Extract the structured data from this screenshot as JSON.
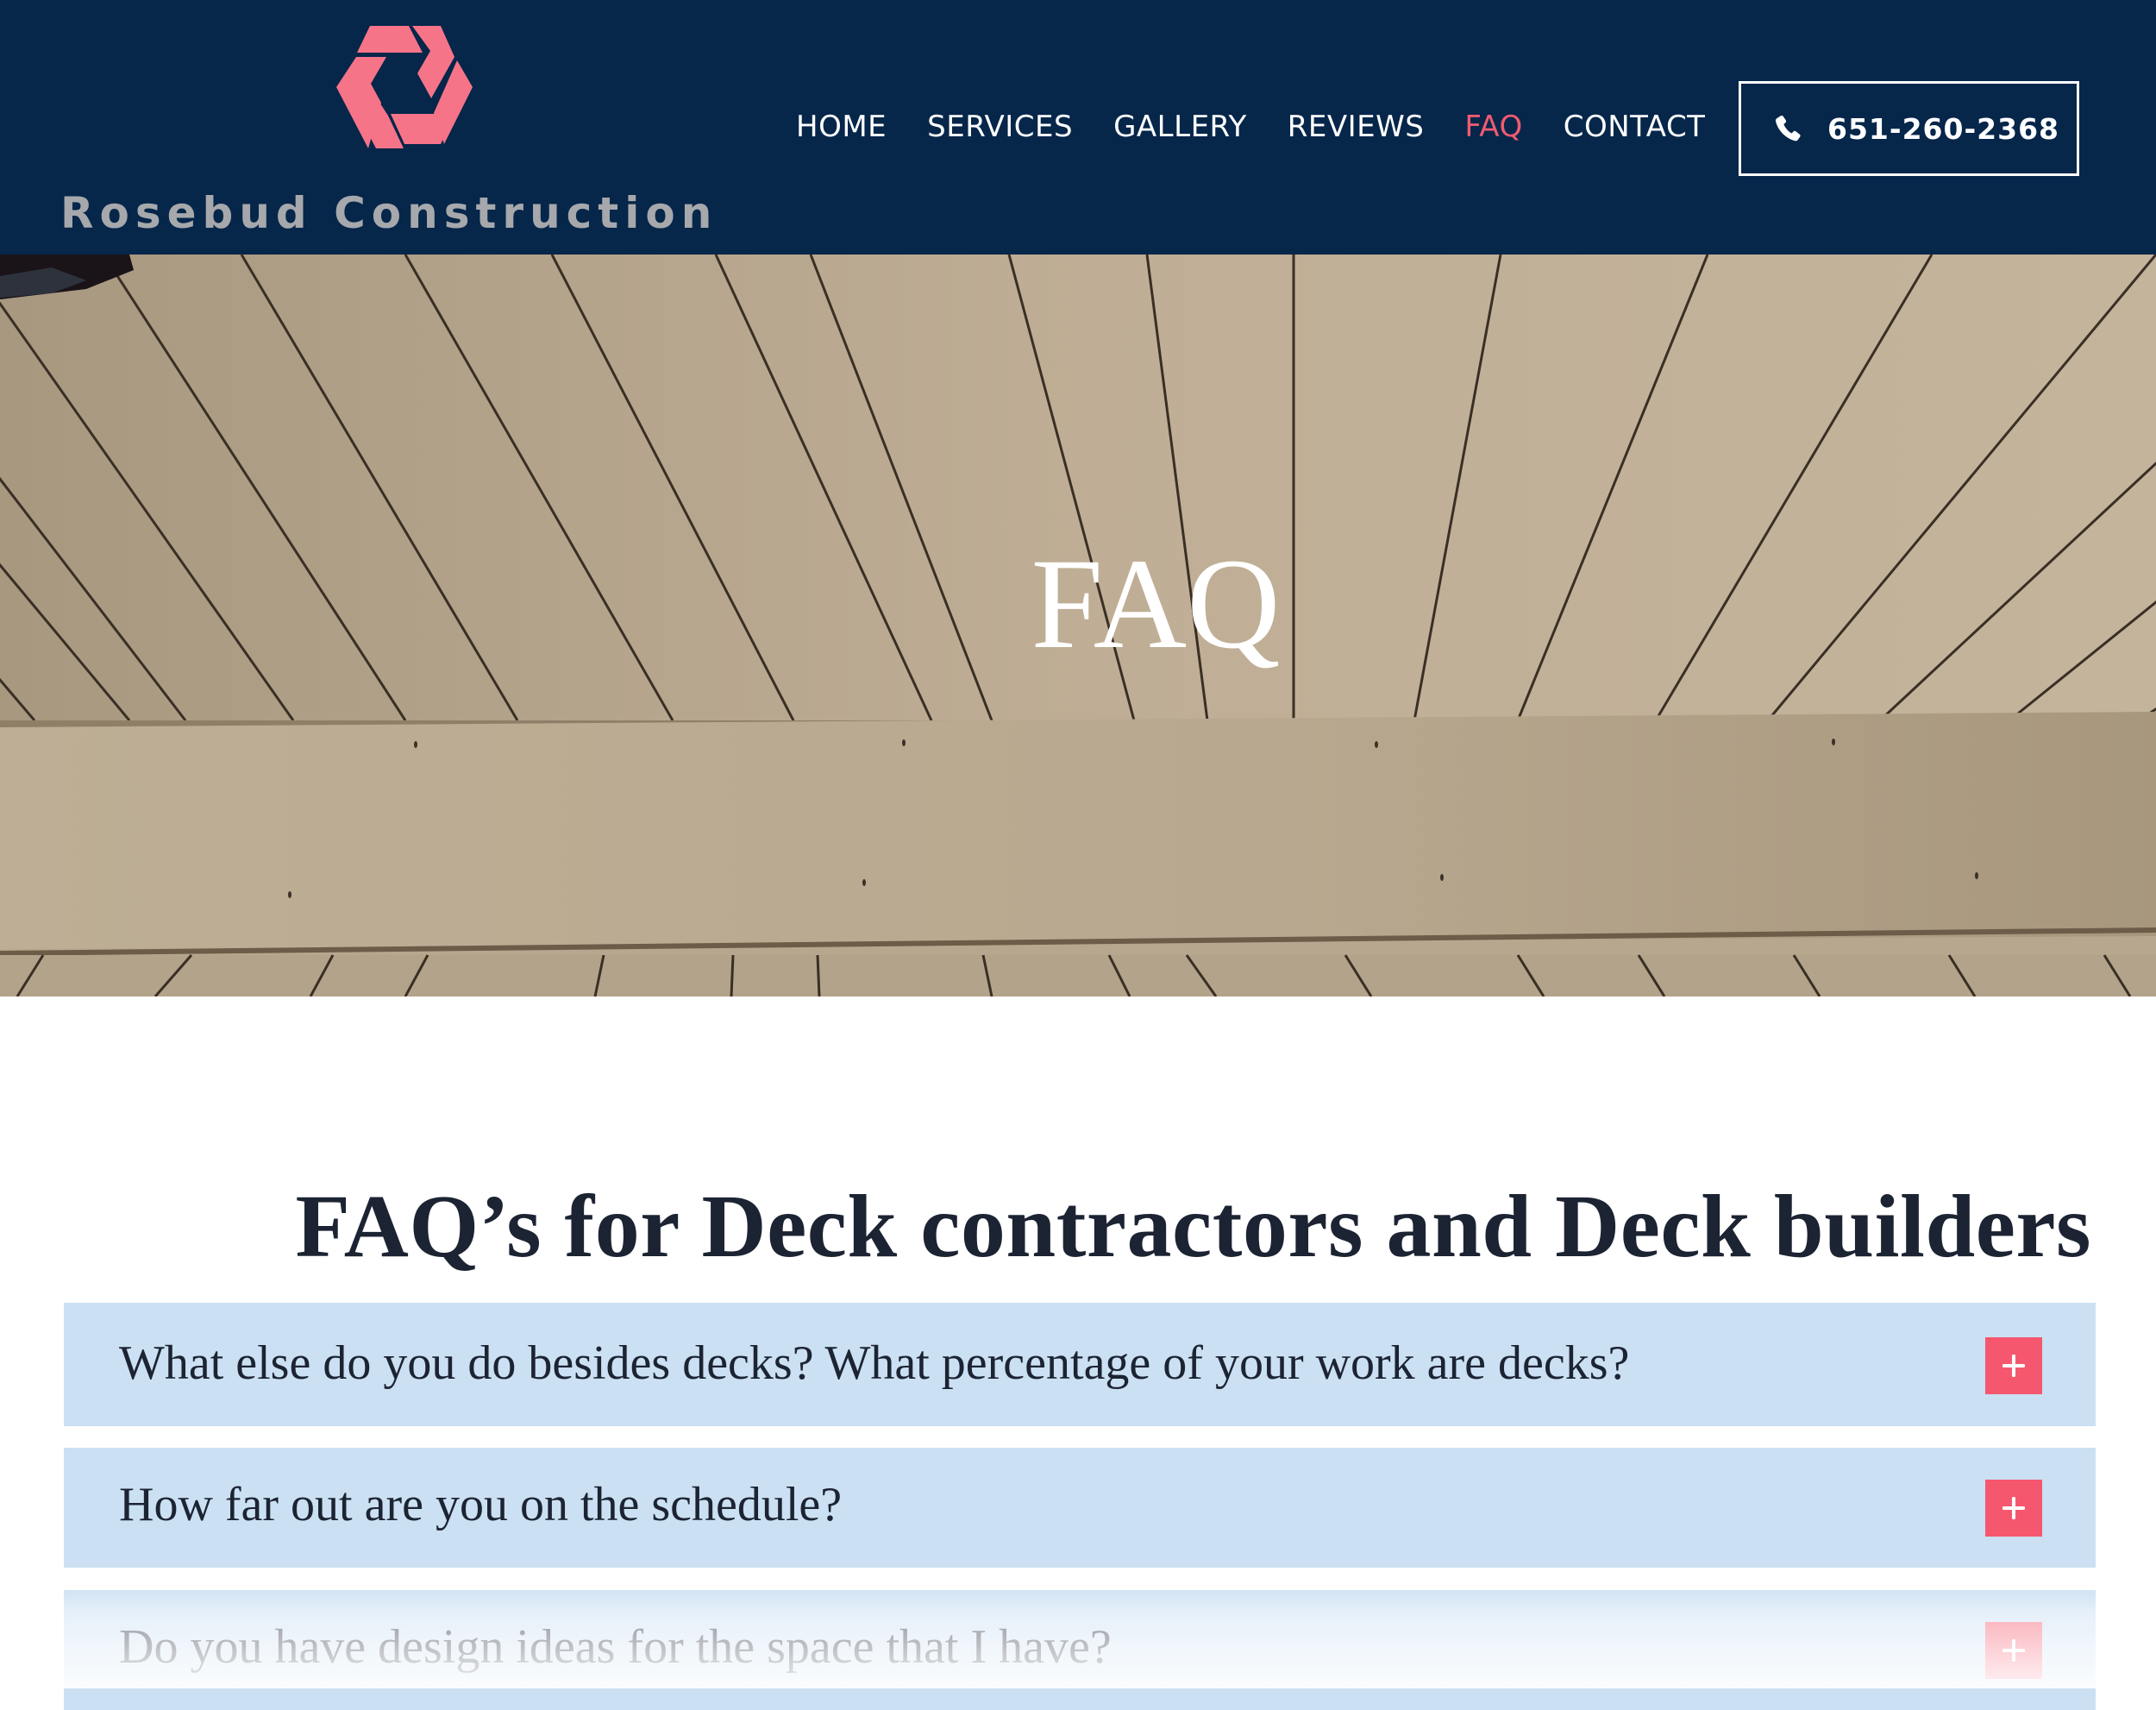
{
  "header": {
    "brand_name": "Rosebud Construction",
    "logo_icon": "hexagon-logo-icon",
    "nav": [
      {
        "label": "HOME",
        "active": false
      },
      {
        "label": "SERVICES",
        "active": false
      },
      {
        "label": "GALLERY",
        "active": false
      },
      {
        "label": "REVIEWS",
        "active": false
      },
      {
        "label": "FAQ",
        "active": true
      },
      {
        "label": "CONTACT",
        "active": false
      }
    ],
    "phone": {
      "icon": "phone-icon",
      "label": "651-260-2368"
    }
  },
  "hero": {
    "title": "FAQ",
    "background": "deck-boards-photo"
  },
  "main": {
    "heading": "FAQ’s for Deck contractors and Deck builders",
    "faqs": [
      {
        "question": "What else do you do besides decks? What percentage of your work are decks?",
        "expanded": false,
        "icon": "plus-icon"
      },
      {
        "question": "How far out are you on the schedule?",
        "expanded": false,
        "icon": "plus-icon"
      },
      {
        "question": "Do you have design ideas for the space that I have?",
        "expanded": false,
        "icon": "plus-icon"
      }
    ]
  },
  "colors": {
    "header_bg": "#06264a",
    "brand_pink": "#f67488",
    "nav_active": "#ef5b70",
    "accordion_bg": "#cbe0f3",
    "accordion_button": "#f5586e",
    "heading_text": "#1c2433"
  }
}
